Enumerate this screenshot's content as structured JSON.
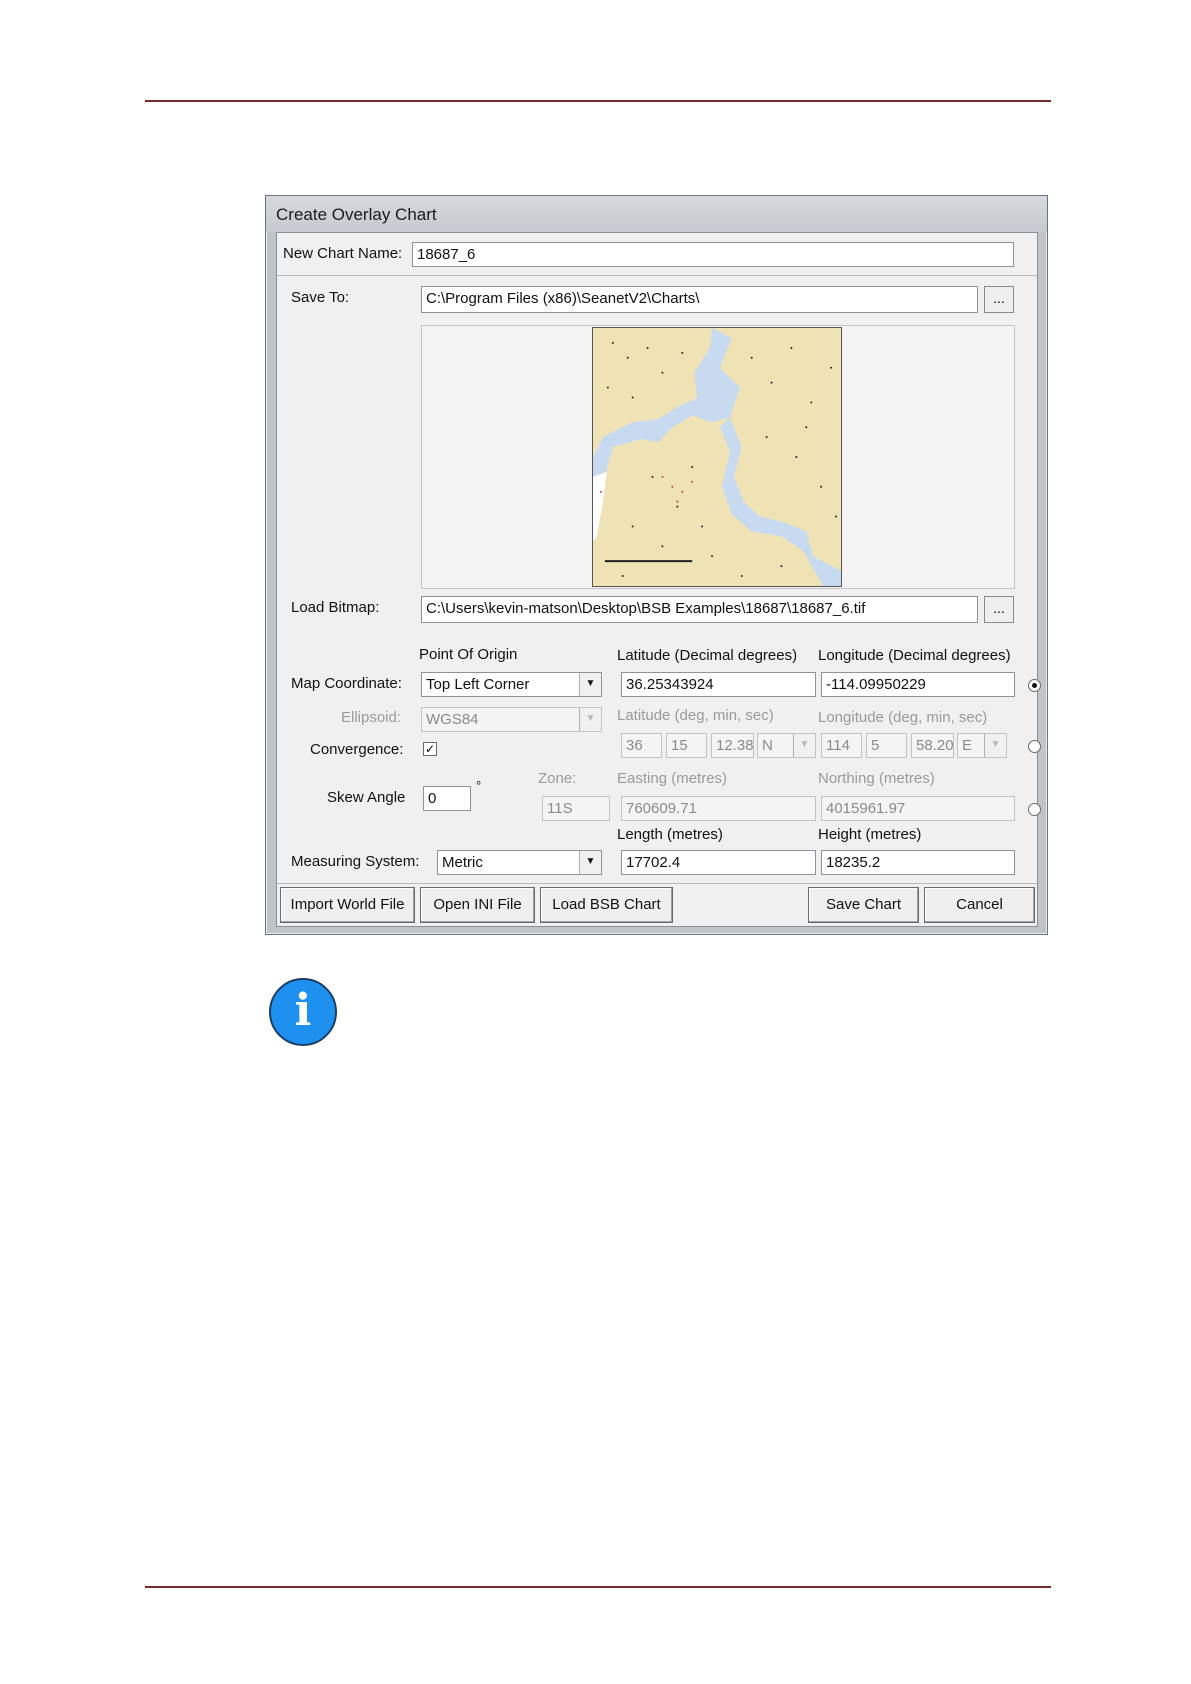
{
  "dialog": {
    "title": "Create Overlay Chart",
    "new_chart_name_label": "New Chart Name:",
    "new_chart_name_value": "18687_6",
    "save_to_label": "Save To:",
    "save_to_value": "C:\\Program Files (x86)\\SeanetV2\\Charts\\",
    "browse_label": "...",
    "load_bitmap_label": "Load Bitmap:",
    "load_bitmap_value": "C:\\Users\\kevin-matson\\Desktop\\BSB Examples\\18687\\18687_6.tif",
    "point_of_origin_label": "Point Of Origin",
    "map_coordinate_label": "Map Coordinate:",
    "map_coordinate_value": "Top Left Corner",
    "latitude_decimal_label": "Latitude (Decimal degrees)",
    "longitude_decimal_label": "Longitude (Decimal degrees)",
    "latitude_decimal_value": "36.25343924",
    "longitude_decimal_value": "-114.09950229",
    "ellipsoid_label": "Ellipsoid:",
    "ellipsoid_value": "WGS84",
    "latitude_dms_label": "Latitude (deg, min, sec)",
    "longitude_dms_label": "Longitude (deg, min, sec)",
    "lat_deg": "36",
    "lat_min": "15",
    "lat_sec": "12.38",
    "lat_hemi": "N",
    "lon_deg": "114",
    "lon_min": "5",
    "lon_sec": "58.20",
    "lon_hemi": "E",
    "convergence_label": "Convergence:",
    "skew_angle_label": "Skew Angle",
    "skew_angle_value": "0",
    "degree_symbol": "°",
    "zone_label": "Zone:",
    "zone_value": "11S",
    "easting_label": "Easting (metres)",
    "easting_value": "760609.71",
    "northing_label": "Northing (metres)",
    "northing_value": "4015961.97",
    "length_label": "Length (metres)",
    "length_value": "17702.4",
    "height_label": "Height (metres)",
    "height_value": "18235.2",
    "measuring_system_label": "Measuring System:",
    "measuring_system_value": "Metric",
    "buttons": {
      "import_world_file": "Import World File",
      "open_ini_file": "Open INI File",
      "load_bsb_chart": "Load BSB Chart",
      "save_chart": "Save Chart",
      "cancel": "Cancel"
    }
  },
  "colors": {
    "rule": "#7a2a2a",
    "info_icon": "#1e90f0",
    "map_land": "#efe3b6",
    "map_water": "#c8daf0"
  }
}
